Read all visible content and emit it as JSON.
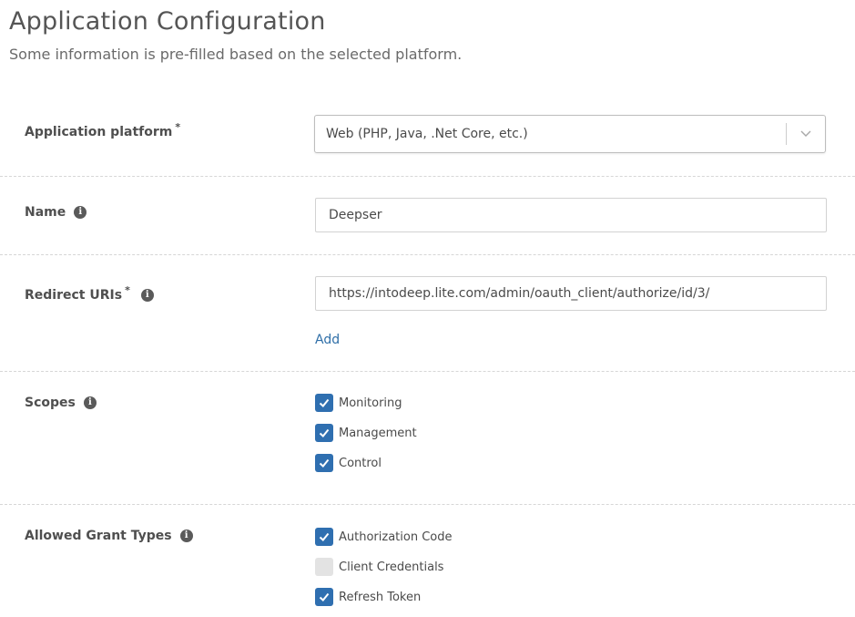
{
  "header": {
    "title": "Application Configuration",
    "subtitle": "Some information is pre-filled based on the selected platform."
  },
  "platform": {
    "label": "Application platform",
    "required_mark": "*",
    "selected": "Web (PHP, Java, .Net Core, etc.)"
  },
  "name": {
    "label": "Name",
    "value": "Deepser"
  },
  "redirect": {
    "label": "Redirect URIs",
    "required_mark": "*",
    "value": "https://intodeep.lite.com/admin/oauth_client/authorize/id/3/",
    "add_label": "Add"
  },
  "scopes": {
    "label": "Scopes",
    "items": [
      {
        "label": "Monitoring",
        "checked": true
      },
      {
        "label": "Management",
        "checked": true
      },
      {
        "label": "Control",
        "checked": true
      }
    ]
  },
  "grant_types": {
    "label": "Allowed Grant Types",
    "items": [
      {
        "label": "Authorization Code",
        "checked": true
      },
      {
        "label": "Client Credentials",
        "checked": false
      },
      {
        "label": "Refresh Token",
        "checked": true
      }
    ]
  },
  "colors": {
    "accent": "#2f6fb0",
    "link": "#2f6fa8",
    "unchecked": "#e3e3e3"
  },
  "icons": {
    "info": "info-icon",
    "dropdown": "chevron-down-icon",
    "check": "check-icon"
  }
}
